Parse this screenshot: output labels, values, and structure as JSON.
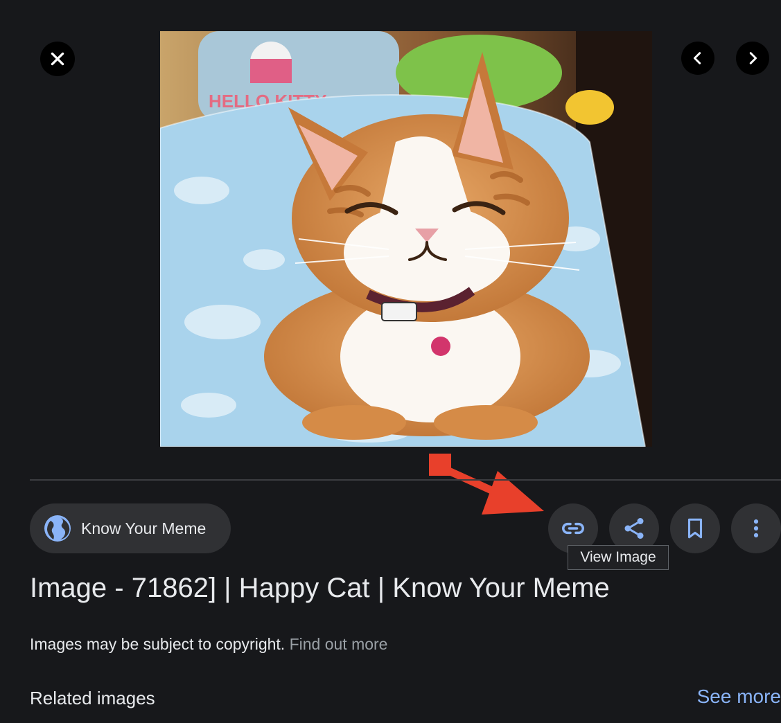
{
  "viewer": {
    "close_icon": "close-icon",
    "prev_icon": "chevron-left-icon",
    "next_icon": "chevron-right-icon",
    "image_subject": "smiling orange and white cat on blue blanket"
  },
  "source": {
    "name": "Know Your Meme",
    "icon": "globe-icon"
  },
  "actions": {
    "link_icon": "link-icon",
    "share_icon": "share-icon",
    "save_icon": "bookmark-icon",
    "more_icon": "more-vert-icon",
    "tooltip": "View Image"
  },
  "details": {
    "title": "Image - 71862] | Happy Cat | Know Your Meme",
    "copyright_text": "Images may be subject to copyright.",
    "find_out_more": "Find out more"
  },
  "related": {
    "heading": "Related images",
    "see_more": "See more"
  },
  "colors": {
    "background": "#17181b",
    "button_bg": "#303134",
    "accent_link": "#8ab4f8",
    "annotation": "#e8402b"
  }
}
